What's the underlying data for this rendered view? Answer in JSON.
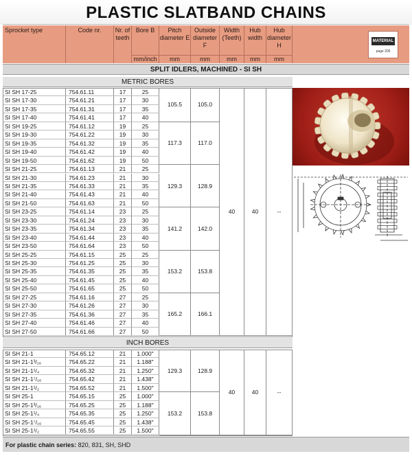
{
  "title": "PLASTIC SLATBAND CHAINS",
  "header": {
    "columns": [
      {
        "key": "type",
        "label": "Sprocket type",
        "unit": ""
      },
      {
        "key": "code",
        "label": "Code nr.",
        "unit": ""
      },
      {
        "key": "teeth",
        "label": "Nr. of teeth",
        "unit": ""
      },
      {
        "key": "bore",
        "label": "Bore B",
        "unit": "mm/inch"
      },
      {
        "key": "pitch",
        "label": "Pitch diameter E",
        "unit": "mm"
      },
      {
        "key": "outside",
        "label": "Outside diameter F",
        "unit": "mm"
      },
      {
        "key": "width",
        "label": "Width (Teeth)",
        "unit": "mm"
      },
      {
        "key": "hub",
        "label": "Hub width",
        "unit": "mm"
      },
      {
        "key": "hubdia",
        "label": "Hub diameter H",
        "unit": "mm"
      }
    ],
    "material_label": "MATERIAL",
    "material_page": "page 205"
  },
  "section_title": "SPLIT IDLERS, MACHINED - SI SH",
  "metric": {
    "label": "METRIC BORES",
    "rows": [
      {
        "type": "SI SH 17-25",
        "code": "754.61.11",
        "teeth": "17",
        "bore": "25"
      },
      {
        "type": "SI SH 17-30",
        "code": "754.61.21",
        "teeth": "17",
        "bore": "30"
      },
      {
        "type": "SI SH 17-35",
        "code": "754.61.31",
        "teeth": "17",
        "bore": "35"
      },
      {
        "type": "SI SH 17-40",
        "code": "754.61.41",
        "teeth": "17",
        "bore": "40"
      },
      {
        "type": "SI SH 19-25",
        "code": "754.61.12",
        "teeth": "19",
        "bore": "25"
      },
      {
        "type": "SI SH 19-30",
        "code": "754.61.22",
        "teeth": "19",
        "bore": "30"
      },
      {
        "type": "SI SH 19-35",
        "code": "754.61.32",
        "teeth": "19",
        "bore": "35"
      },
      {
        "type": "SI SH 19-40",
        "code": "754.61.42",
        "teeth": "19",
        "bore": "40"
      },
      {
        "type": "SI SH 19-50",
        "code": "754.61.62",
        "teeth": "19",
        "bore": "50"
      },
      {
        "type": "SI SH 21-25",
        "code": "754.61.13",
        "teeth": "21",
        "bore": "25"
      },
      {
        "type": "SI SH 21-30",
        "code": "754.61.23",
        "teeth": "21",
        "bore": "30"
      },
      {
        "type": "SI SH 21-35",
        "code": "754.61.33",
        "teeth": "21",
        "bore": "35"
      },
      {
        "type": "SI SH 21-40",
        "code": "754.61.43",
        "teeth": "21",
        "bore": "40"
      },
      {
        "type": "SI SH 21-50",
        "code": "754.61.63",
        "teeth": "21",
        "bore": "50"
      },
      {
        "type": "SI SH 23-25",
        "code": "754.61.14",
        "teeth": "23",
        "bore": "25"
      },
      {
        "type": "SI SH 23-30",
        "code": "754.61.24",
        "teeth": "23",
        "bore": "30"
      },
      {
        "type": "SI SH 23-35",
        "code": "754.61.34",
        "teeth": "23",
        "bore": "35"
      },
      {
        "type": "SI SH 23-40",
        "code": "754.61.44",
        "teeth": "23",
        "bore": "40"
      },
      {
        "type": "SI SH 23-50",
        "code": "754.61.64",
        "teeth": "23",
        "bore": "50"
      },
      {
        "type": "SI SH 25-25",
        "code": "754.61.15",
        "teeth": "25",
        "bore": "25"
      },
      {
        "type": "SI SH 25-30",
        "code": "754.61.25",
        "teeth": "25",
        "bore": "30"
      },
      {
        "type": "SI SH 25-35",
        "code": "754.61.35",
        "teeth": "25",
        "bore": "35"
      },
      {
        "type": "SI SH 25-40",
        "code": "754.61.45",
        "teeth": "25",
        "bore": "40"
      },
      {
        "type": "SI SH 25-50",
        "code": "754.61.65",
        "teeth": "25",
        "bore": "50"
      },
      {
        "type": "SI SH 27-25",
        "code": "754.61.16",
        "teeth": "27",
        "bore": "25"
      },
      {
        "type": "SI SH 27-30",
        "code": "754.61.26",
        "teeth": "27",
        "bore": "30"
      },
      {
        "type": "SI SH 27-35",
        "code": "754.61.36",
        "teeth": "27",
        "bore": "35"
      },
      {
        "type": "SI SH 27-40",
        "code": "754.61.46",
        "teeth": "27",
        "bore": "40"
      },
      {
        "type": "SI SH 27-50",
        "code": "754.61.66",
        "teeth": "27",
        "bore": "50"
      }
    ],
    "groups": [
      {
        "pitch": "105.5",
        "outside": "105.0"
      },
      {
        "pitch": "117.3",
        "outside": "117.0"
      },
      {
        "pitch": "129.3",
        "outside": "128.9"
      },
      {
        "pitch": "141.2",
        "outside": "142.0"
      },
      {
        "pitch": "153.2",
        "outside": "153.8"
      },
      {
        "pitch": "165.2",
        "outside": "166.1"
      }
    ],
    "width": "40",
    "hub": "40",
    "hubdia": "--"
  },
  "inch": {
    "label": "INCH BORES",
    "rows": [
      {
        "type": "SI SH 21-1",
        "code": "754.65.12",
        "teeth": "21",
        "bore": "1.000\""
      },
      {
        "type": "SI SH 21-1³/₁₆",
        "code": "754.65.22",
        "teeth": "21",
        "bore": "1.188\""
      },
      {
        "type": "SI SH 21-1¹/₄",
        "code": "754.65.32",
        "teeth": "21",
        "bore": "1.250\""
      },
      {
        "type": "SI SH 21-1⁷/₁₆",
        "code": "754.65.42",
        "teeth": "21",
        "bore": "1.438\""
      },
      {
        "type": "SI SH 21-1¹/₂",
        "code": "754.65.52",
        "teeth": "21",
        "bore": "1.500\""
      },
      {
        "type": "SI SH 25-1",
        "code": "754.65.15",
        "teeth": "25",
        "bore": "1.000\""
      },
      {
        "type": "SI SH 25-1³/₁₆",
        "code": "754.65.25",
        "teeth": "25",
        "bore": "1.188\""
      },
      {
        "type": "SI SH 25-1¹/₄",
        "code": "754.65.35",
        "teeth": "25",
        "bore": "1.250\""
      },
      {
        "type": "SI SH 25-1⁷/₁₆",
        "code": "754.65.45",
        "teeth": "25",
        "bore": "1.438\""
      },
      {
        "type": "SI SH 25-1¹/₂",
        "code": "754.65.55",
        "teeth": "25",
        "bore": "1.500\""
      }
    ],
    "groups": [
      {
        "pitch": "129.3",
        "outside": "128.9"
      },
      {
        "pitch": "153.2",
        "outside": "153.8"
      }
    ],
    "width": "40",
    "hub": "40",
    "hubdia": "--"
  },
  "footer": {
    "label": "For plastic chain series:",
    "value": "820, 831, SH, SHD"
  }
}
